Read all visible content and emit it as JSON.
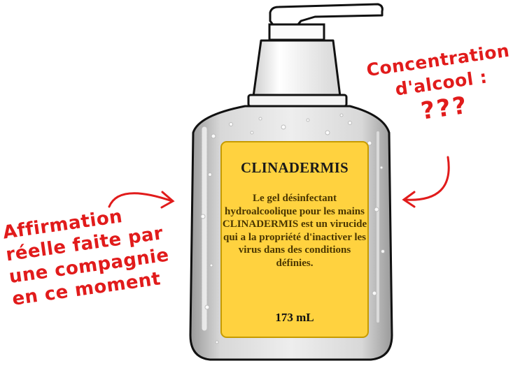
{
  "bottle": {
    "label_bg": "#ffd23f",
    "brand": "CLINADERMIS",
    "description": "Le gel désinfectant hydroalcoolique pour les mains CLINADERMIS est un virucide qui a la propriété d'inactiver les virus dans des conditions définies.",
    "volume": "173 mL"
  },
  "annotations": {
    "left": "Affirmation réelle faite par une compagnie en ce moment",
    "right_line1": "Concentration",
    "right_line2": "d'alcool :",
    "right_question": "???",
    "color": "#e11b1b"
  },
  "icons": [
    "pump-bottle",
    "arrow-right",
    "arrow-left"
  ]
}
